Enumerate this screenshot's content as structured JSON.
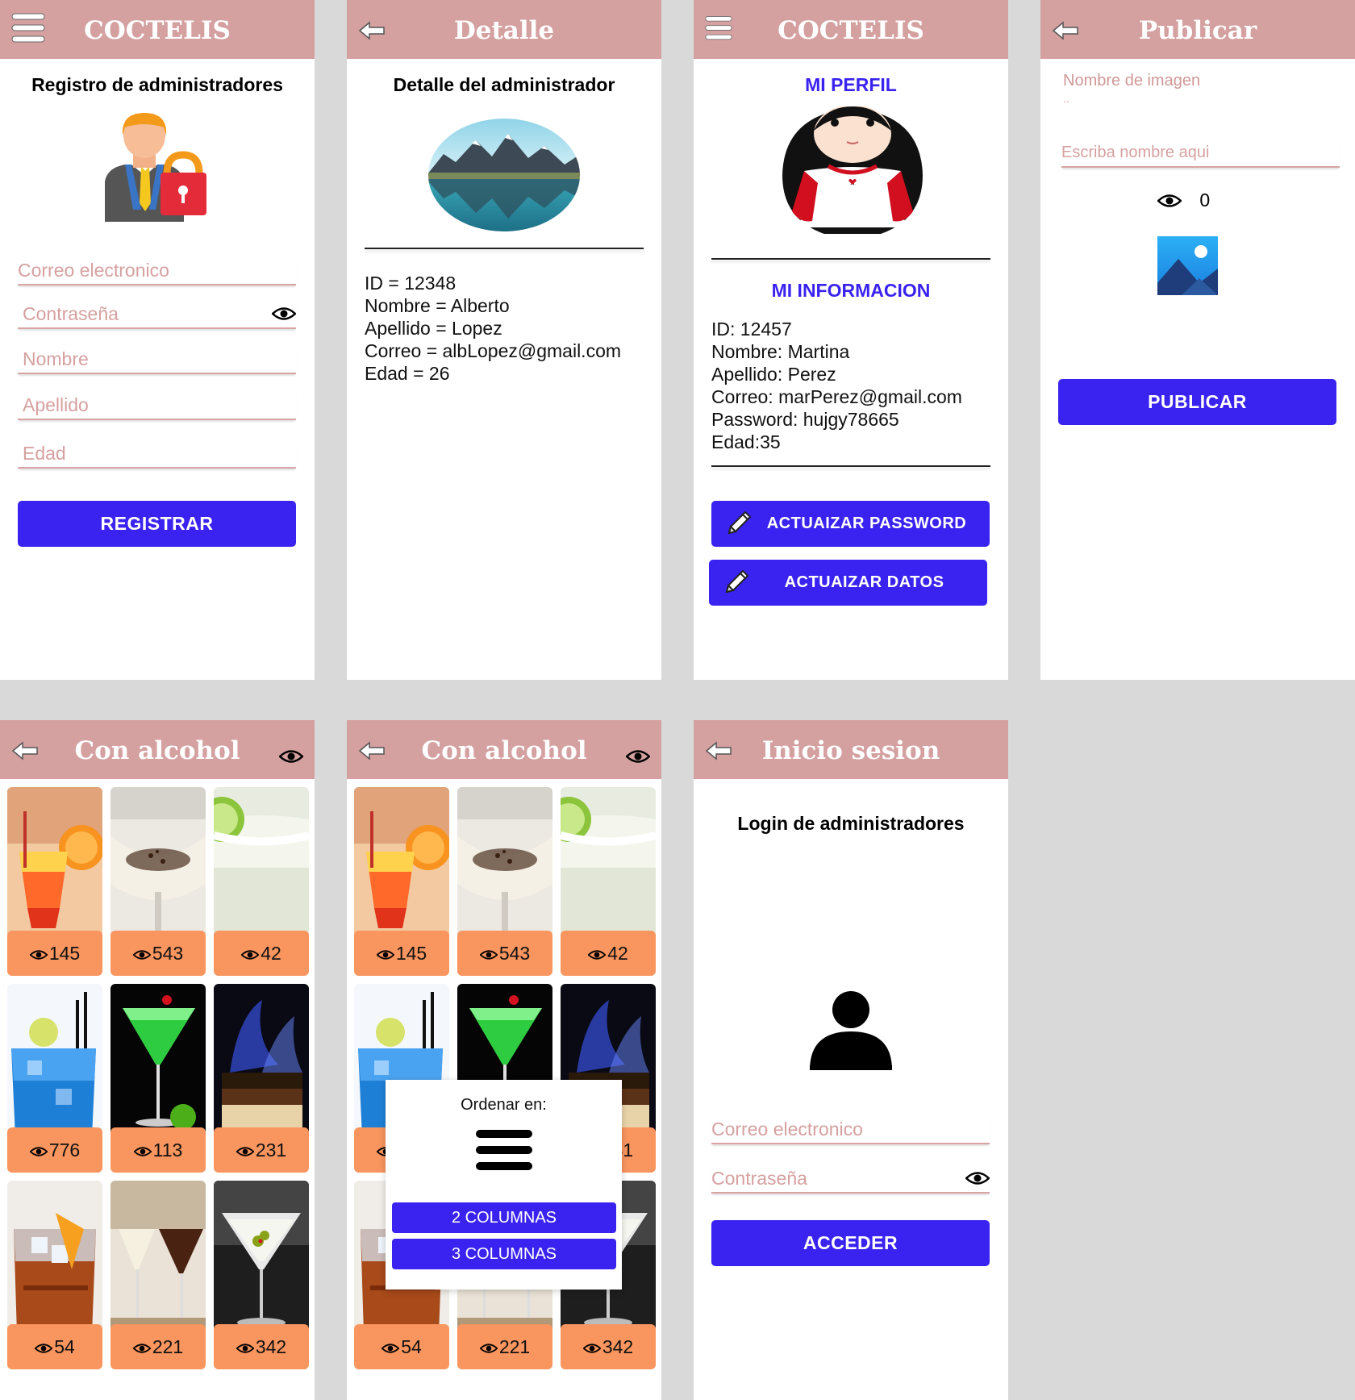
{
  "registro": {
    "app_title": "COCTELIS",
    "heading": "Registro de administradores",
    "fields": {
      "email_placeholder": "Correo electronico",
      "password_placeholder": "Contraseña",
      "name_placeholder": "Nombre",
      "lastname_placeholder": "Apellido",
      "age_placeholder": "Edad"
    },
    "button": "REGISTRAR"
  },
  "detalle": {
    "title": "Detalle",
    "heading": "Detalle del administrador",
    "lines": [
      "ID = 12348",
      "Nombre = Alberto",
      "Apellido = Lopez",
      "Correo = albLopez@gmail.com",
      "Edad = 26"
    ]
  },
  "perfil": {
    "app_title": "COCTELIS",
    "heading": "MI PERFIL",
    "info_heading": "MI INFORMACION",
    "lines": [
      "ID: 12457",
      "Nombre: Martina",
      "Apellido: Perez",
      "Correo: marPerez@gmail.com",
      "Password: hujgy78665",
      "Edad:35"
    ],
    "buttons": {
      "password": "ACTUAIZAR PASSWORD",
      "datos": "ACTUAIZAR DATOS"
    }
  },
  "publicar": {
    "title": "Publicar",
    "label": "Nombre de imagen",
    "sub_label": "..",
    "input_placeholder": "Escriba nombre aqui",
    "views": "0",
    "button": "PUBLICAR"
  },
  "con_alcohol": {
    "title": "Con alcohol",
    "items": [
      {
        "views": "145"
      },
      {
        "views": "543"
      },
      {
        "views": "42"
      },
      {
        "views": "776"
      },
      {
        "views": "113"
      },
      {
        "views": "231"
      },
      {
        "views": "54"
      },
      {
        "views": "221"
      },
      {
        "views": "342"
      }
    ]
  },
  "ordenar": {
    "title": "Ordenar en:",
    "option_2": "2 COLUMNAS",
    "option_3": "3 COLUMNAS"
  },
  "login": {
    "title": "Inicio sesion",
    "heading": "Login de administradores",
    "email_placeholder": "Correo electronico",
    "password_placeholder": "Contraseña",
    "button": "ACCEDER"
  },
  "colors": {
    "header_bg": "#d4a0a0",
    "primary_button": "#3a22f0",
    "count_badge": "#f9955e",
    "accent_text": "#3a22f0"
  }
}
